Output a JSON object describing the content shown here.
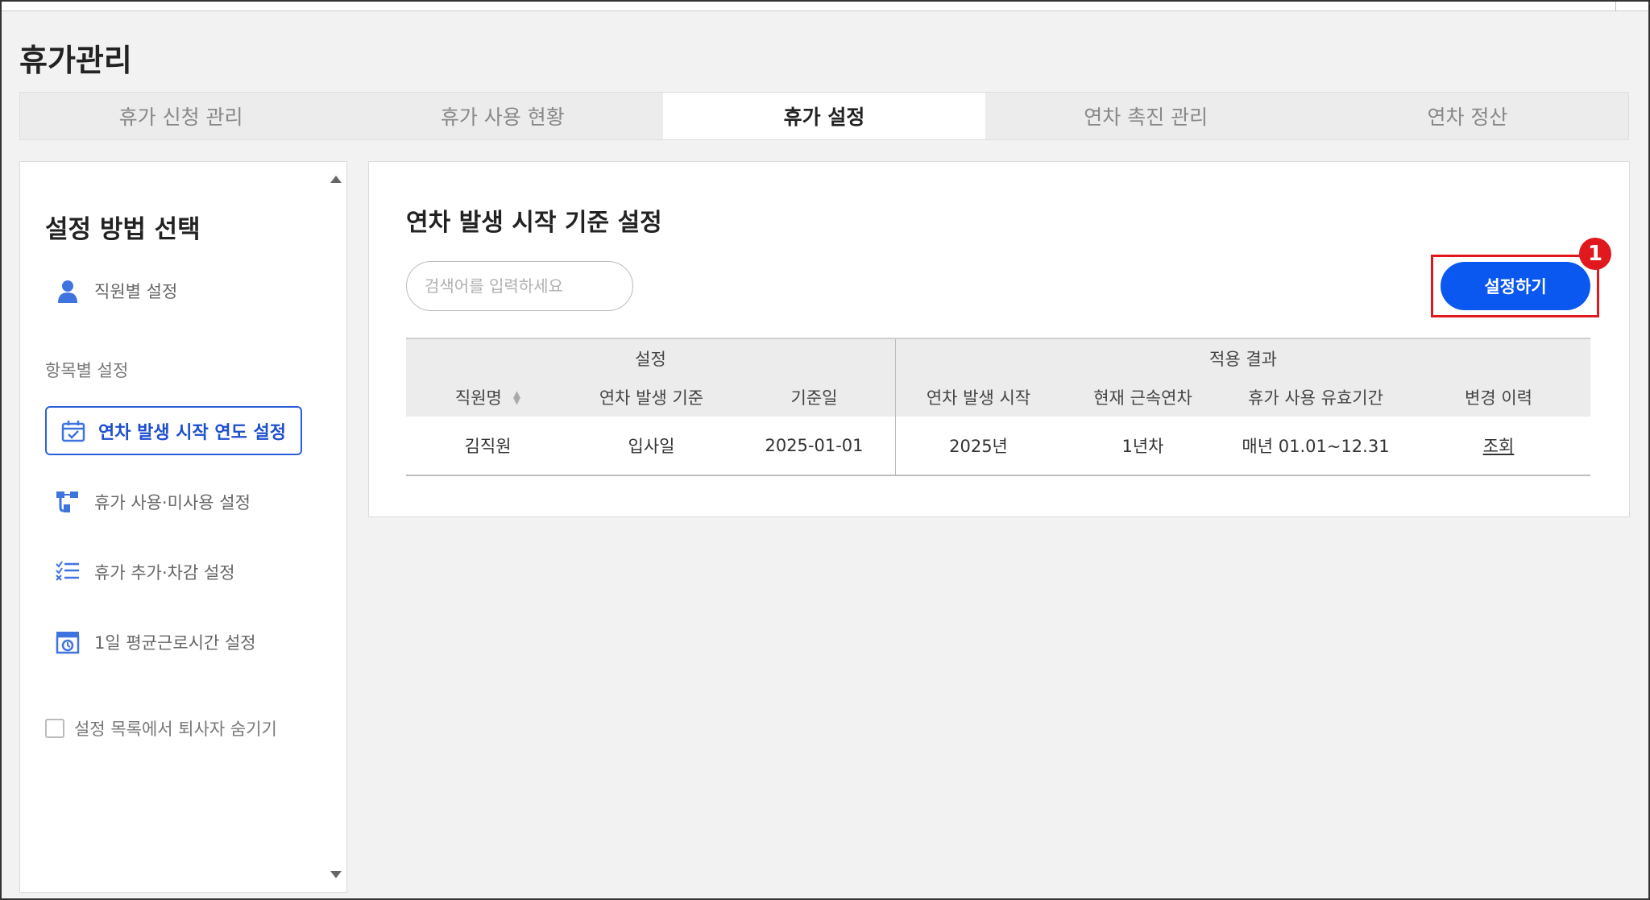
{
  "page": {
    "title": "휴가관리"
  },
  "tabs": [
    {
      "label": "휴가 신청 관리"
    },
    {
      "label": "휴가 사용 현황"
    },
    {
      "label": "휴가 설정",
      "active": true
    },
    {
      "label": "연차 촉진 관리"
    },
    {
      "label": "연차 정산"
    }
  ],
  "sidebar": {
    "title": "설정 방법 선택",
    "employee_item": {
      "label": "직원별 설정",
      "icon": "person-icon"
    },
    "group_label": "항목별 설정",
    "items": [
      {
        "label": "연차 발생 시작 연도 설정",
        "icon": "calendar-check-icon",
        "active": true
      },
      {
        "label": "휴가 사용·미사용 설정",
        "icon": "flow-icon"
      },
      {
        "label": "휴가 추가·차감 설정",
        "icon": "checklist-icon"
      },
      {
        "label": "1일 평균근로시간 설정",
        "icon": "clock-box-icon"
      }
    ],
    "hide_retired_label": "설정 목록에서 퇴사자 숨기기",
    "hide_retired_checked": false
  },
  "main": {
    "title": "연차 발생 시작 기준 설정",
    "search": {
      "placeholder": "검색어를 입력하세요",
      "value": ""
    },
    "setting_button": "설정하기",
    "step_badge": "1",
    "table": {
      "group_headers": {
        "setting": "설정",
        "result": "적용 결과"
      },
      "columns": [
        "직원명",
        "연차 발생 기준",
        "기준일",
        "연차 발생 시작",
        "현재 근속연차",
        "휴가 사용 유효기간",
        "변경 이력"
      ],
      "rows": [
        [
          "김직원",
          "입사일",
          "2025-01-01",
          "2025년",
          "1년차",
          "매년 01.01~12.31",
          "조회"
        ]
      ]
    }
  },
  "colors": {
    "accent": "#0a58f0",
    "highlight": "#e0191e",
    "active_border": "#2b5fd9"
  }
}
